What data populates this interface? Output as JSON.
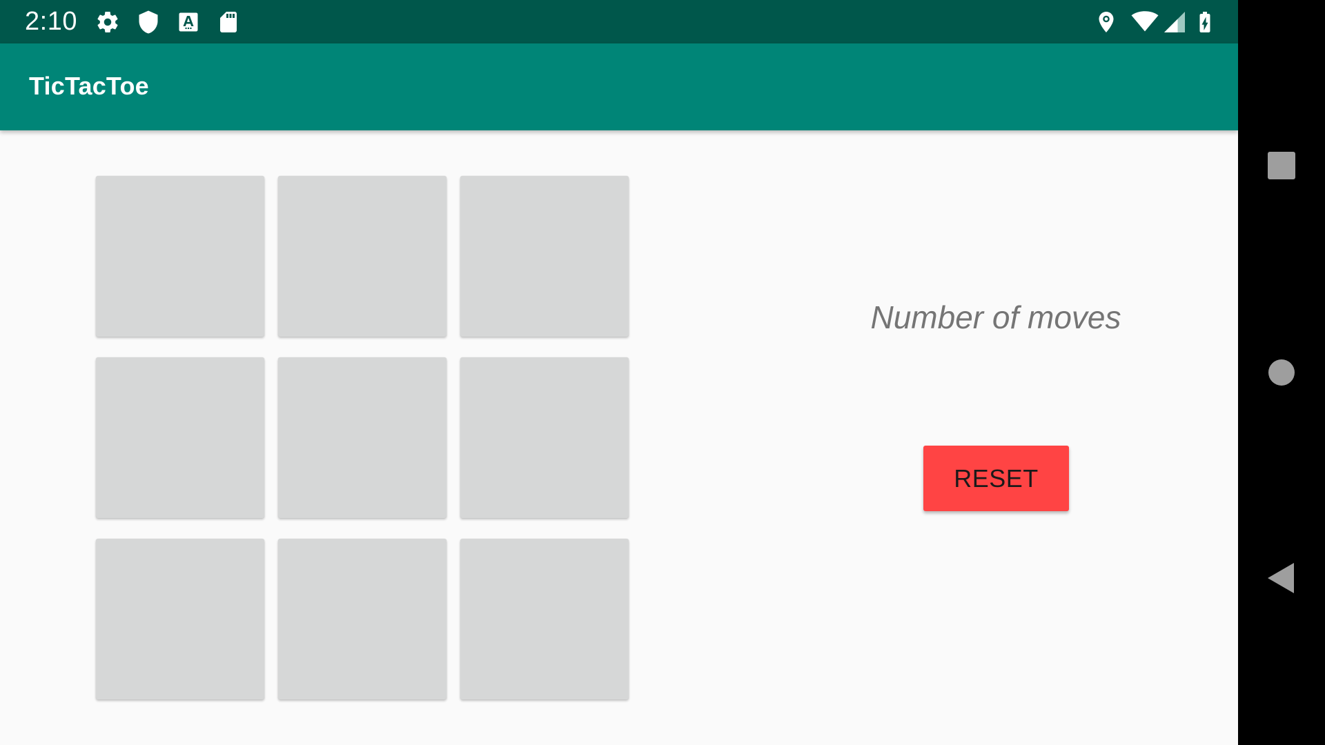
{
  "status_bar": {
    "time": "2:10",
    "left_icons": [
      "gear-icon",
      "shield-icon",
      "font-a-icon",
      "sd-card-icon"
    ],
    "right_icons": [
      "location-pin-icon",
      "wifi-icon",
      "cell-signal-icon",
      "battery-charging-icon"
    ]
  },
  "app_bar": {
    "title": "TicTacToe"
  },
  "board": {
    "rows": 3,
    "cols": 3,
    "cells": [
      "",
      "",
      "",
      "",
      "",
      "",
      "",
      "",
      ""
    ]
  },
  "side_panel": {
    "moves_label": "Number of moves",
    "reset_label": "RESET"
  },
  "nav_bar": {
    "buttons": [
      "recents-square-icon",
      "home-circle-icon",
      "back-triangle-icon"
    ]
  },
  "colors": {
    "status_bar": "#00574b",
    "app_bar": "#008577",
    "background": "#fafafa",
    "cell": "#d6d7d7",
    "reset_button": "#ff4444",
    "moves_text": "#757575",
    "nav_icon": "#9e9e9e"
  }
}
